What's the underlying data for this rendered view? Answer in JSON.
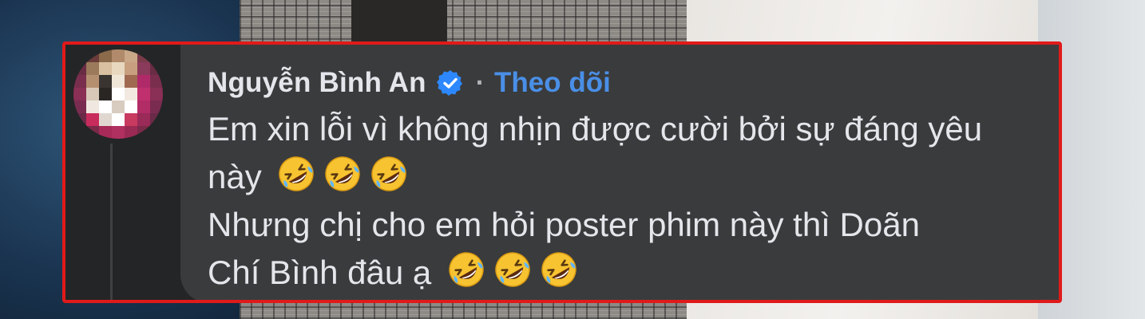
{
  "comment": {
    "author_name": "Nguyễn Bình An",
    "separator": "·",
    "follow_label": "Theo dõi",
    "lines": [
      {
        "text": "Em xin lỗi vì không nhịn được cười bởi sự đáng yêu",
        "emoji_count": 0
      },
      {
        "text": "này",
        "emoji_count": 3
      },
      {
        "text": "Nhưng chị cho em hỏi poster phim này thì Doãn",
        "emoji_count": 0
      },
      {
        "text": "Chí Bình đâu ạ",
        "emoji_count": 3
      }
    ],
    "emoji_icon": "rolling-on-the-floor-laughing",
    "verified_icon": "verified-badge"
  },
  "colors": {
    "highlight_border": "#e01a1a",
    "panel_bg": "#242526",
    "bubble_bg": "#3a3b3c",
    "text": "#e4e6eb",
    "link": "#4a8fe7",
    "badge": "#2d88ff"
  }
}
